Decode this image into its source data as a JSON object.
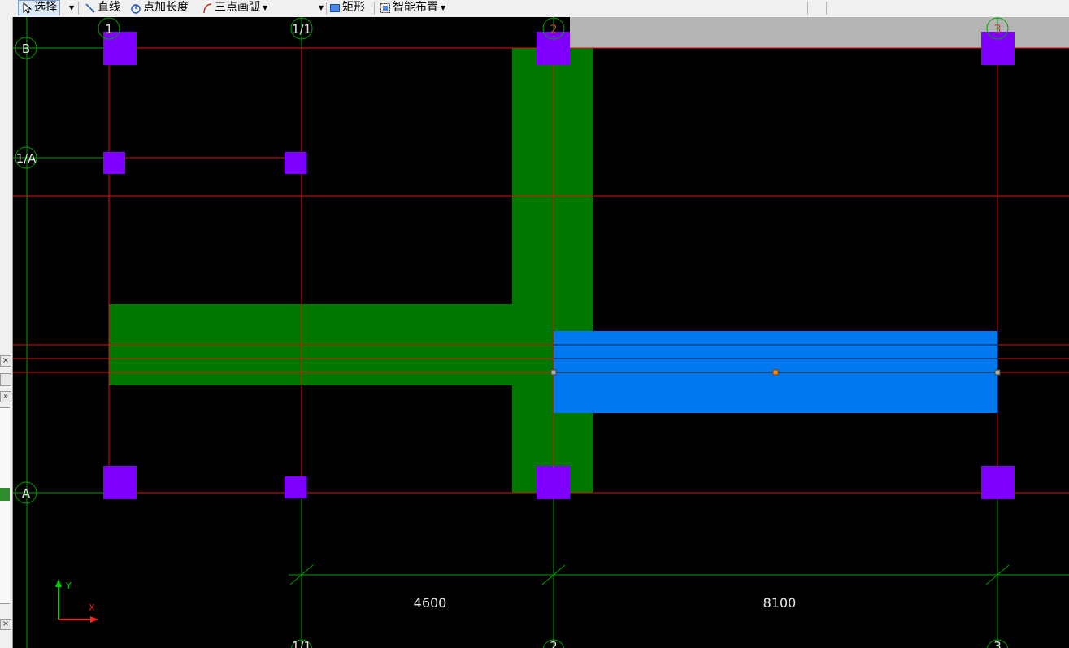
{
  "toolbar": {
    "select_label": "选择",
    "line_label": "直线",
    "point_length_label": "点加长度",
    "arc_label": "三点画弧",
    "dropdown_value": "",
    "rect_label": "矩形",
    "smart_layout_label": "智能布置"
  },
  "left_strip": {
    "close_1": "×",
    "expand": "»",
    "close_2": "×"
  },
  "axes": {
    "col_1": "1",
    "col_1_1": "1/1",
    "col_2": "2",
    "col_3": "3",
    "row_B": "B",
    "row_1A": "1/A",
    "row_A": "A"
  },
  "dimensions": {
    "dim_1": "4600",
    "dim_2": "8100"
  },
  "ucs": {
    "x_label": "X",
    "y_label": "Y"
  },
  "colors": {
    "column": "#7f00ff",
    "wall": "#007800",
    "beam_selected": "#0078f0",
    "grid_axis": "#00a000",
    "grid_line": "#e01010",
    "background": "#000000",
    "dimension_text": "#e8e8e8"
  }
}
